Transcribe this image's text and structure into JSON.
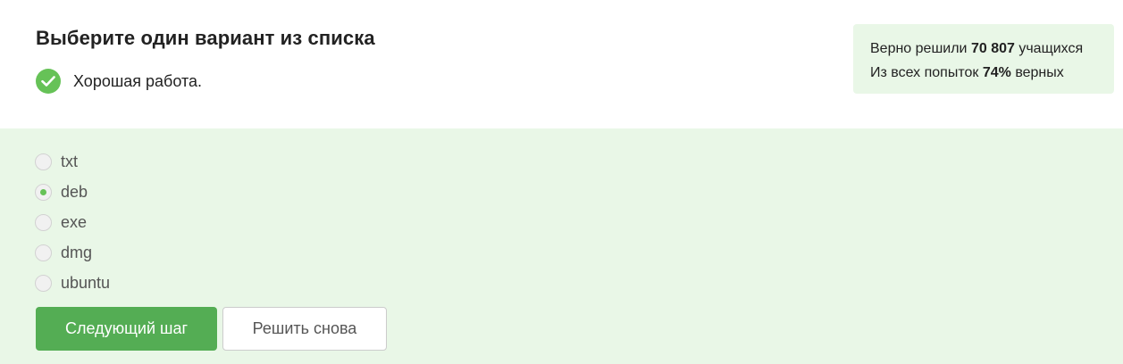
{
  "header": {
    "title": "Выберите один вариант из списка",
    "feedback": "Хорошая работа."
  },
  "stats": {
    "solved_prefix": "Верно решили",
    "solved_count": "70 807",
    "solved_suffix": "учащихся",
    "attempts_prefix": "Из всех попыток",
    "attempts_percent": "74%",
    "attempts_suffix": "верных"
  },
  "options": [
    {
      "label": "txt",
      "selected": false
    },
    {
      "label": "deb",
      "selected": true
    },
    {
      "label": "exe",
      "selected": false
    },
    {
      "label": "dmg",
      "selected": false
    },
    {
      "label": "ubuntu",
      "selected": false
    }
  ],
  "buttons": {
    "next": "Следующий шаг",
    "retry": "Решить снова"
  },
  "colors": {
    "accent": "#66c257",
    "primary_button": "#54ad54",
    "answer_background": "#e9f7e7"
  },
  "icons": {
    "feedback": "check-icon"
  }
}
